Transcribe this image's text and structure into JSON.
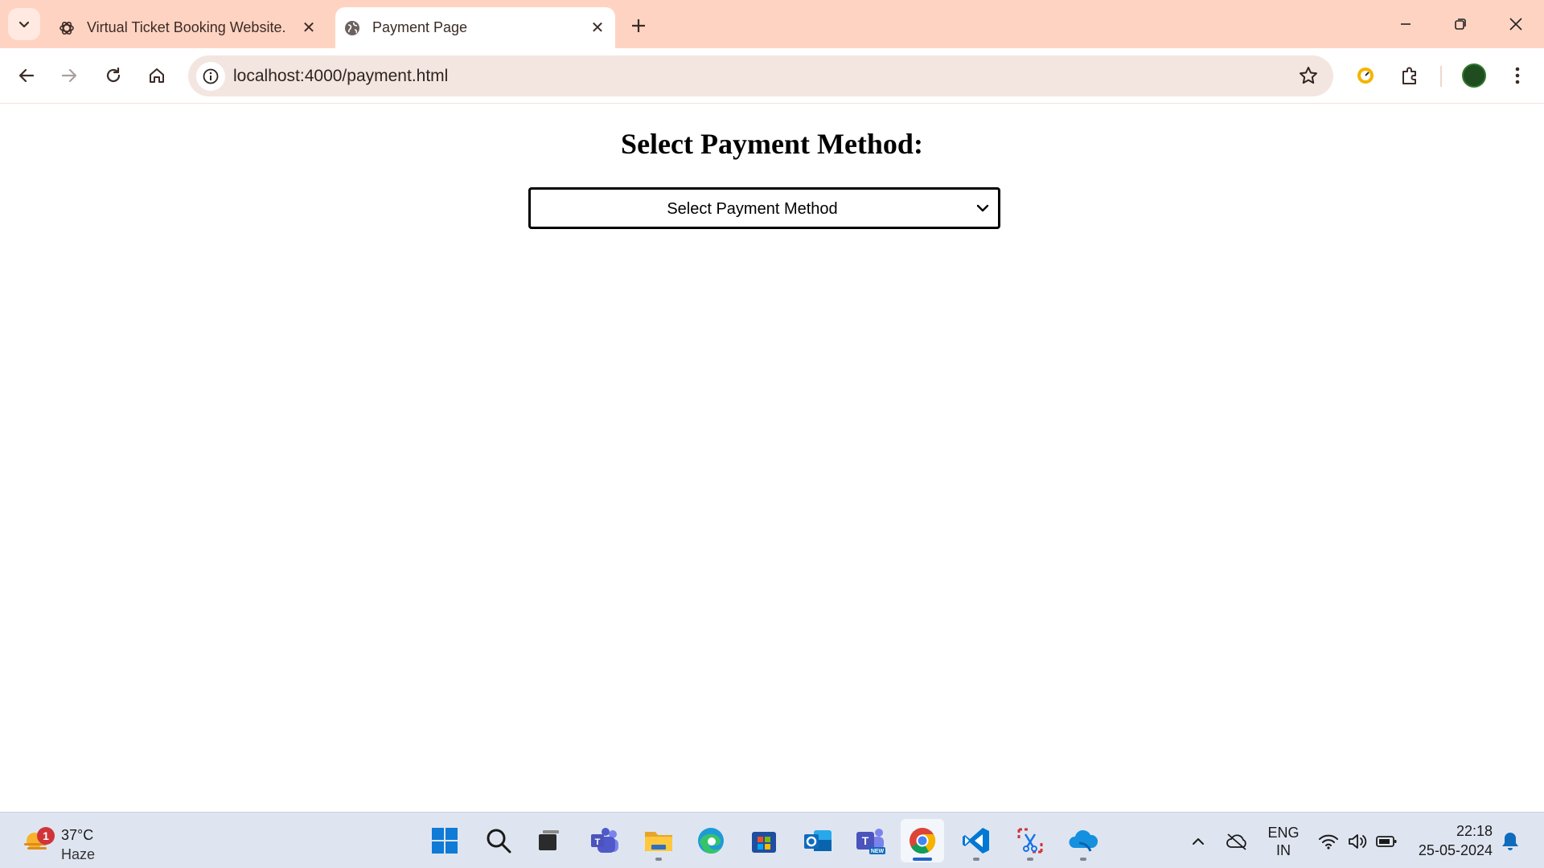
{
  "browser": {
    "tabs": [
      {
        "title": "Virtual Ticket Booking Website.",
        "favicon": "openai-icon",
        "active": false
      },
      {
        "title": "Payment Page",
        "favicon": "globe-icon",
        "active": true
      }
    ],
    "url": "localhost:4000/payment.html",
    "accent": "#ffd3c2"
  },
  "page": {
    "heading": "Select Payment Method:",
    "payment_select": {
      "selected": "Select Payment Method"
    }
  },
  "taskbar": {
    "weather": {
      "temperature": "37°C",
      "condition": "Haze",
      "badge": "1"
    },
    "apps": [
      "start",
      "search",
      "task-view",
      "teams",
      "file-explorer",
      "edge",
      "store",
      "outlook",
      "teams-new",
      "chrome",
      "vscode",
      "snipping-tool",
      "onedrive"
    ],
    "language": {
      "line1": "ENG",
      "line2": "IN"
    },
    "clock": {
      "time": "22:18",
      "date": "25-05-2024"
    }
  }
}
